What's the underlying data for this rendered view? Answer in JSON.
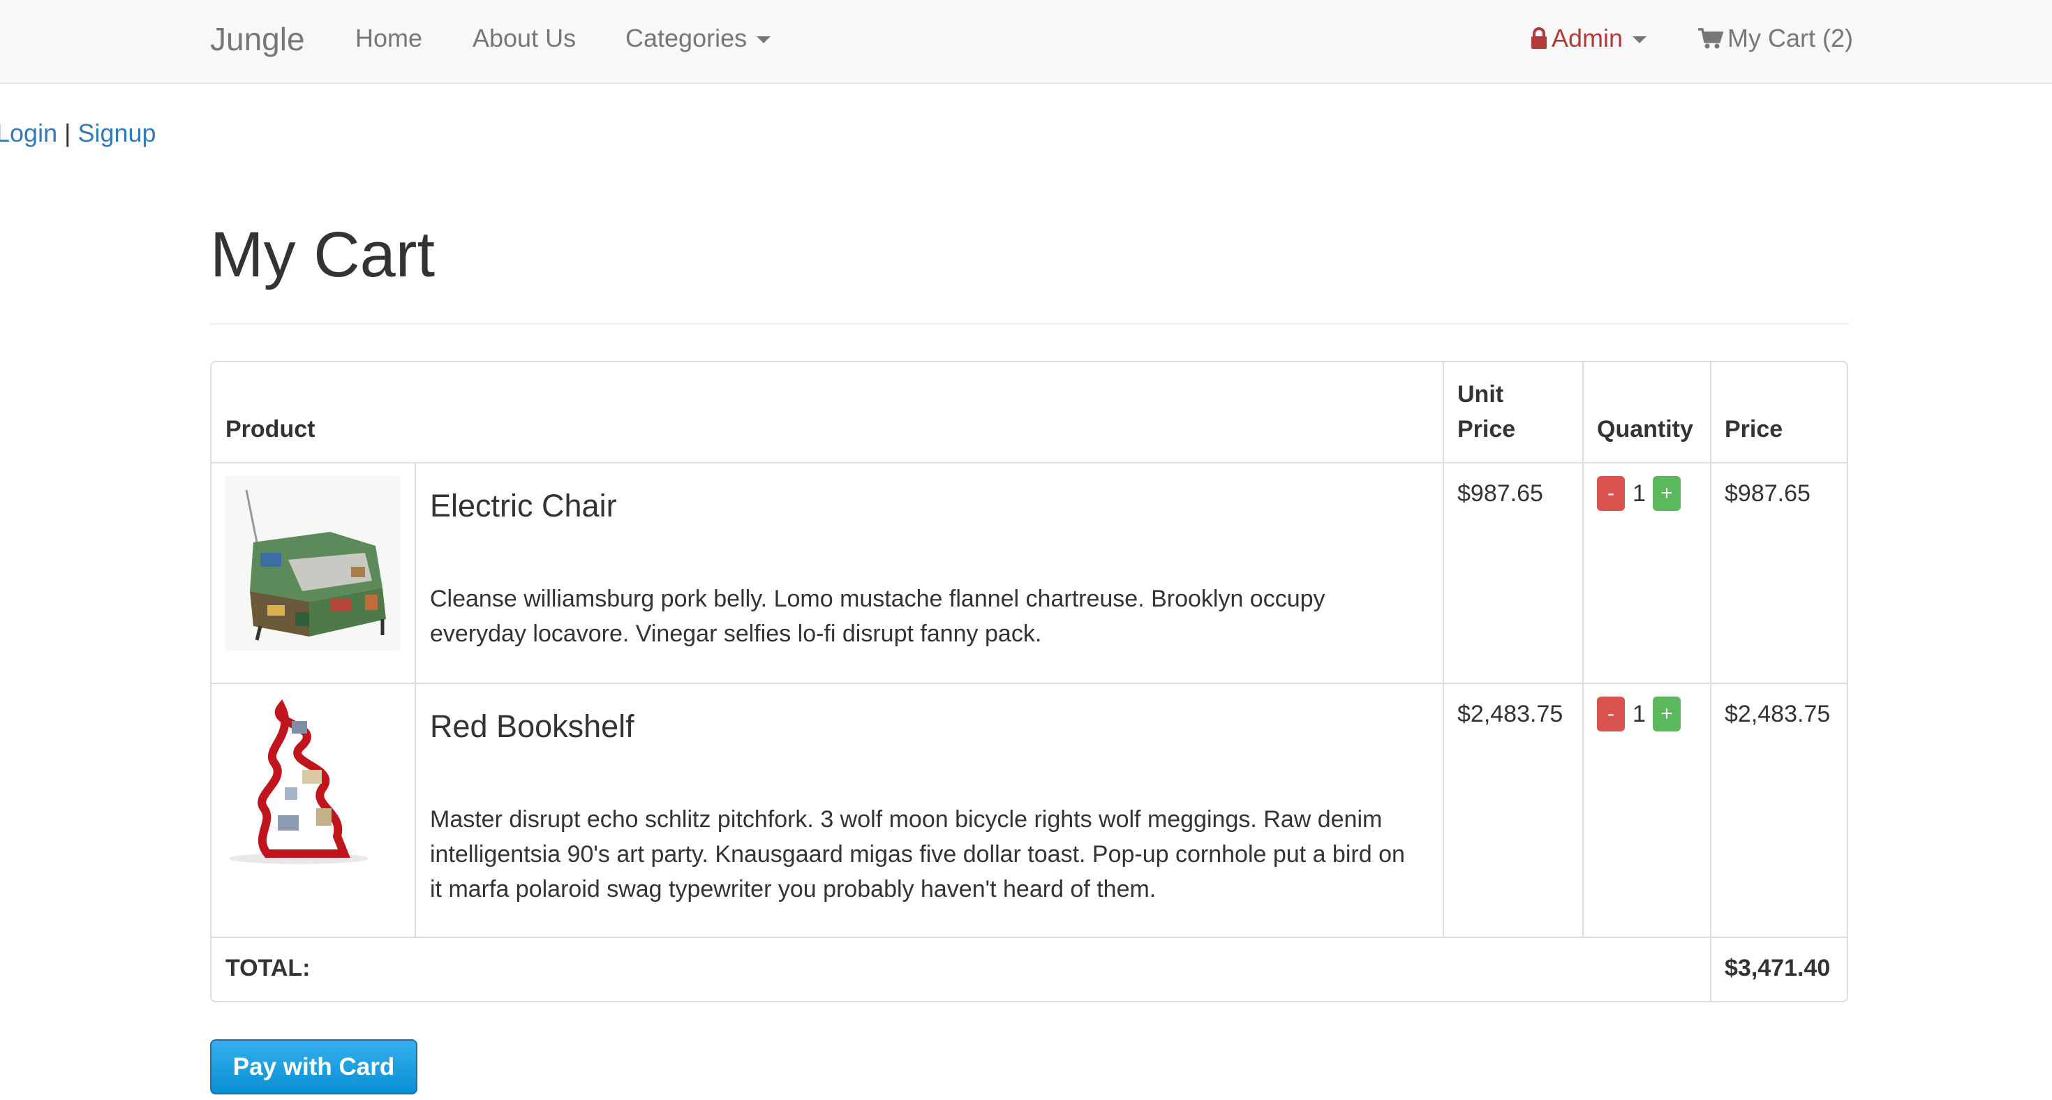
{
  "navbar": {
    "brand": "Jungle",
    "home": "Home",
    "about": "About Us",
    "categories": "Categories",
    "admin": "Admin",
    "cart": "My Cart (2)"
  },
  "auth": {
    "login": "Login",
    "separator": "|",
    "signup": "Signup"
  },
  "page": {
    "title": "My Cart"
  },
  "table": {
    "headers": {
      "product": "Product",
      "unit_price_line1": "Unit",
      "unit_price_line2": "Price",
      "quantity": "Quantity",
      "price": "Price"
    },
    "items": [
      {
        "name": "Electric Chair",
        "description": "Cleanse williamsburg pork belly. Lomo mustache flannel chartreuse. Brooklyn occupy everyday locavore. Vinegar selfies lo-fi disrupt fanny pack.",
        "unit_price": "$987.65",
        "minus": "-",
        "quantity": "1",
        "plus": "+",
        "price": "$987.65"
      },
      {
        "name": "Red Bookshelf",
        "description": "Master disrupt echo schlitz pitchfork. 3 wolf moon bicycle rights wolf meggings. Raw denim intelligentsia 90's art party. Knausgaard migas five dollar toast. Pop-up cornhole put a bird on it marfa polaroid swag typewriter you probably haven't heard of them.",
        "unit_price": "$2,483.75",
        "minus": "-",
        "quantity": "1",
        "plus": "+",
        "price": "$2,483.75"
      }
    ],
    "total_label": "TOTAL:",
    "total_value": "$3,471.40"
  },
  "pay_button": "Pay with Card",
  "colors": {
    "link": "#337ab7",
    "admin": "#b33a3a",
    "minus": "#d9534f",
    "plus": "#5cb85c",
    "pay": "#0a8fd5"
  },
  "icons": {
    "admin": "lock-icon",
    "cart": "shopping-cart-icon",
    "dropdown": "caret-down-icon"
  }
}
